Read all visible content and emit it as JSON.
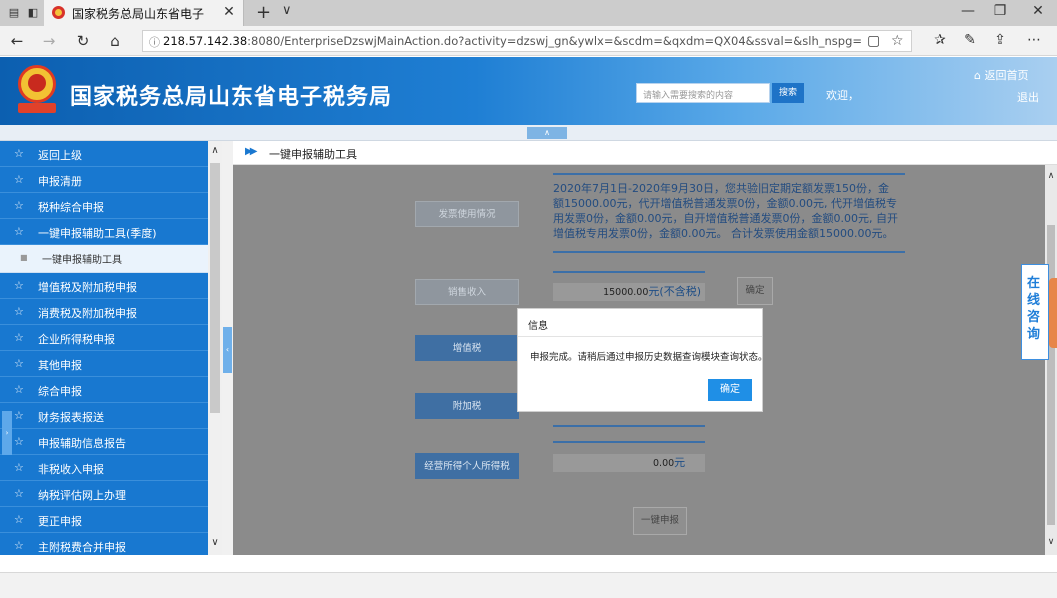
{
  "browser": {
    "tab_title": "国家税务总局山东省电子",
    "url_host": "218.57.142.38",
    "url_rest": ":8080/EnterpriseDzswjMainAction.do?activity=dzswj_gn&ywlx=&scdm=&qxdm=QX04&ssval=&slh_nspg="
  },
  "header": {
    "site_title": "国家税务总局山东省电子税务局",
    "search_placeholder": "请输入需要搜索的内容",
    "search_button": "搜索",
    "welcome": "欢迎，",
    "home_link": "返回首页",
    "logout": "退出"
  },
  "sidebar": {
    "items": [
      {
        "label": "返回上级"
      },
      {
        "label": "申报清册"
      },
      {
        "label": "税种综合申报"
      },
      {
        "label": "一键申报辅助工具(季度)"
      },
      {
        "label": "一键申报辅助工具"
      },
      {
        "label": "增值税及附加税申报"
      },
      {
        "label": "消费税及附加税申报"
      },
      {
        "label": "企业所得税申报"
      },
      {
        "label": "其他申报"
      },
      {
        "label": "综合申报"
      },
      {
        "label": "财务报表报送"
      },
      {
        "label": "申报辅助信息报告"
      },
      {
        "label": "非税收入申报"
      },
      {
        "label": "纳税评估网上办理"
      },
      {
        "label": "更正申报"
      },
      {
        "label": "主附税费合并申报"
      }
    ]
  },
  "main": {
    "title": "一键申报辅助工具",
    "invoice_button": "发票使用情况",
    "invoice_info": "2020年7月1日-2020年9月30日，您共验旧定期定额发票150份，金额15000.00元，代开增值税普通发票0份，金额0.00元, 代开增值税专用发票0份，金额0.00元，自开增值税普通发票0份，金额0.00元, 自开增值税专用发票0份，金额0.00元。 合计发票使用金额15000.00元。",
    "sales_button": "销售收入",
    "sales_value": "15000.00",
    "sales_unit": "元(不含税)",
    "confirm_button": "确定",
    "vat_button": "增值税",
    "surcharge_button": "附加税",
    "personal_tax_button": "经营所得个人所得税",
    "personal_value": "0.00",
    "personal_unit": "元",
    "one_click_button": "一键申报"
  },
  "dialog": {
    "title": "信息",
    "message": "申报完成。请稍后通过申报历史数据查询模块查询状态。",
    "ok": "确定"
  },
  "consult": {
    "label": "在线咨询"
  }
}
